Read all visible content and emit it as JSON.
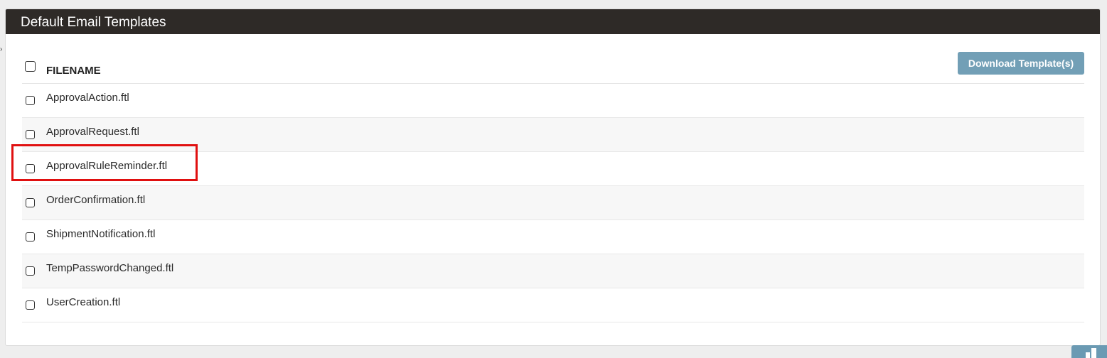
{
  "panel": {
    "title": "Default Email Templates"
  },
  "table": {
    "column_header": "FILENAME",
    "download_button_label": "Download Template(s)",
    "rows": [
      {
        "filename": "ApprovalAction.ftl"
      },
      {
        "filename": "ApprovalRequest.ftl"
      },
      {
        "filename": "ApprovalRuleReminder.ftl"
      },
      {
        "filename": "OrderConfirmation.ftl"
      },
      {
        "filename": "ShipmentNotification.ftl"
      },
      {
        "filename": "TempPasswordChanged.ftl"
      },
      {
        "filename": "UserCreation.ftl"
      }
    ]
  },
  "colors": {
    "header_bg": "#2e2a27",
    "button_bg": "#6b9ab3",
    "highlight_border": "#e01010"
  }
}
